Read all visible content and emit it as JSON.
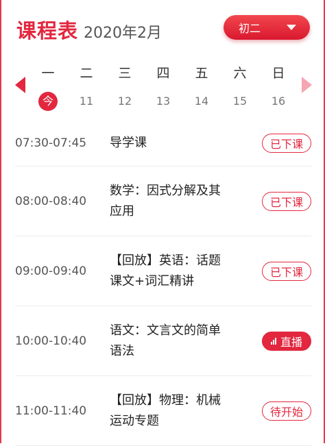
{
  "header": {
    "title": "课程表",
    "month": "2020年2月"
  },
  "grade_select": {
    "selected": "初二"
  },
  "week": {
    "days": [
      {
        "weekday": "一",
        "date": "今",
        "today": true
      },
      {
        "weekday": "二",
        "date": "11",
        "today": false
      },
      {
        "weekday": "三",
        "date": "12",
        "today": false
      },
      {
        "weekday": "四",
        "date": "13",
        "today": false
      },
      {
        "weekday": "五",
        "date": "14",
        "today": false
      },
      {
        "weekday": "六",
        "date": "15",
        "today": false
      },
      {
        "weekday": "日",
        "date": "16",
        "today": false
      }
    ]
  },
  "schedule": [
    {
      "time": "07:30-07:45",
      "lines": [
        "导学课"
      ],
      "status": "已下课",
      "status_type": "ended"
    },
    {
      "time": "08:00-08:40",
      "lines": [
        "数学：因式分解及其",
        "应用"
      ],
      "status": "已下课",
      "status_type": "ended"
    },
    {
      "time": "09:00-09:40",
      "lines": [
        "【回放】英语：话题",
        "课文+词汇精讲"
      ],
      "status": "已下课",
      "status_type": "ended"
    },
    {
      "time": "10:00-10:40",
      "lines": [
        "语文：文言文的简单",
        "语法"
      ],
      "status": "直播",
      "status_type": "live"
    },
    {
      "time": "11:00-11:40",
      "lines": [
        "【回放】物理：机械",
        "运动专题"
      ],
      "status": "待开始",
      "status_type": "upcoming"
    }
  ],
  "colors": {
    "accent": "#e2273f",
    "arrow_disabled": "#f5a6b3"
  },
  "icons": {
    "prev": "chevron-left-icon",
    "next": "chevron-right-icon",
    "dropdown": "caret-down-icon",
    "live": "live-bars-icon"
  }
}
